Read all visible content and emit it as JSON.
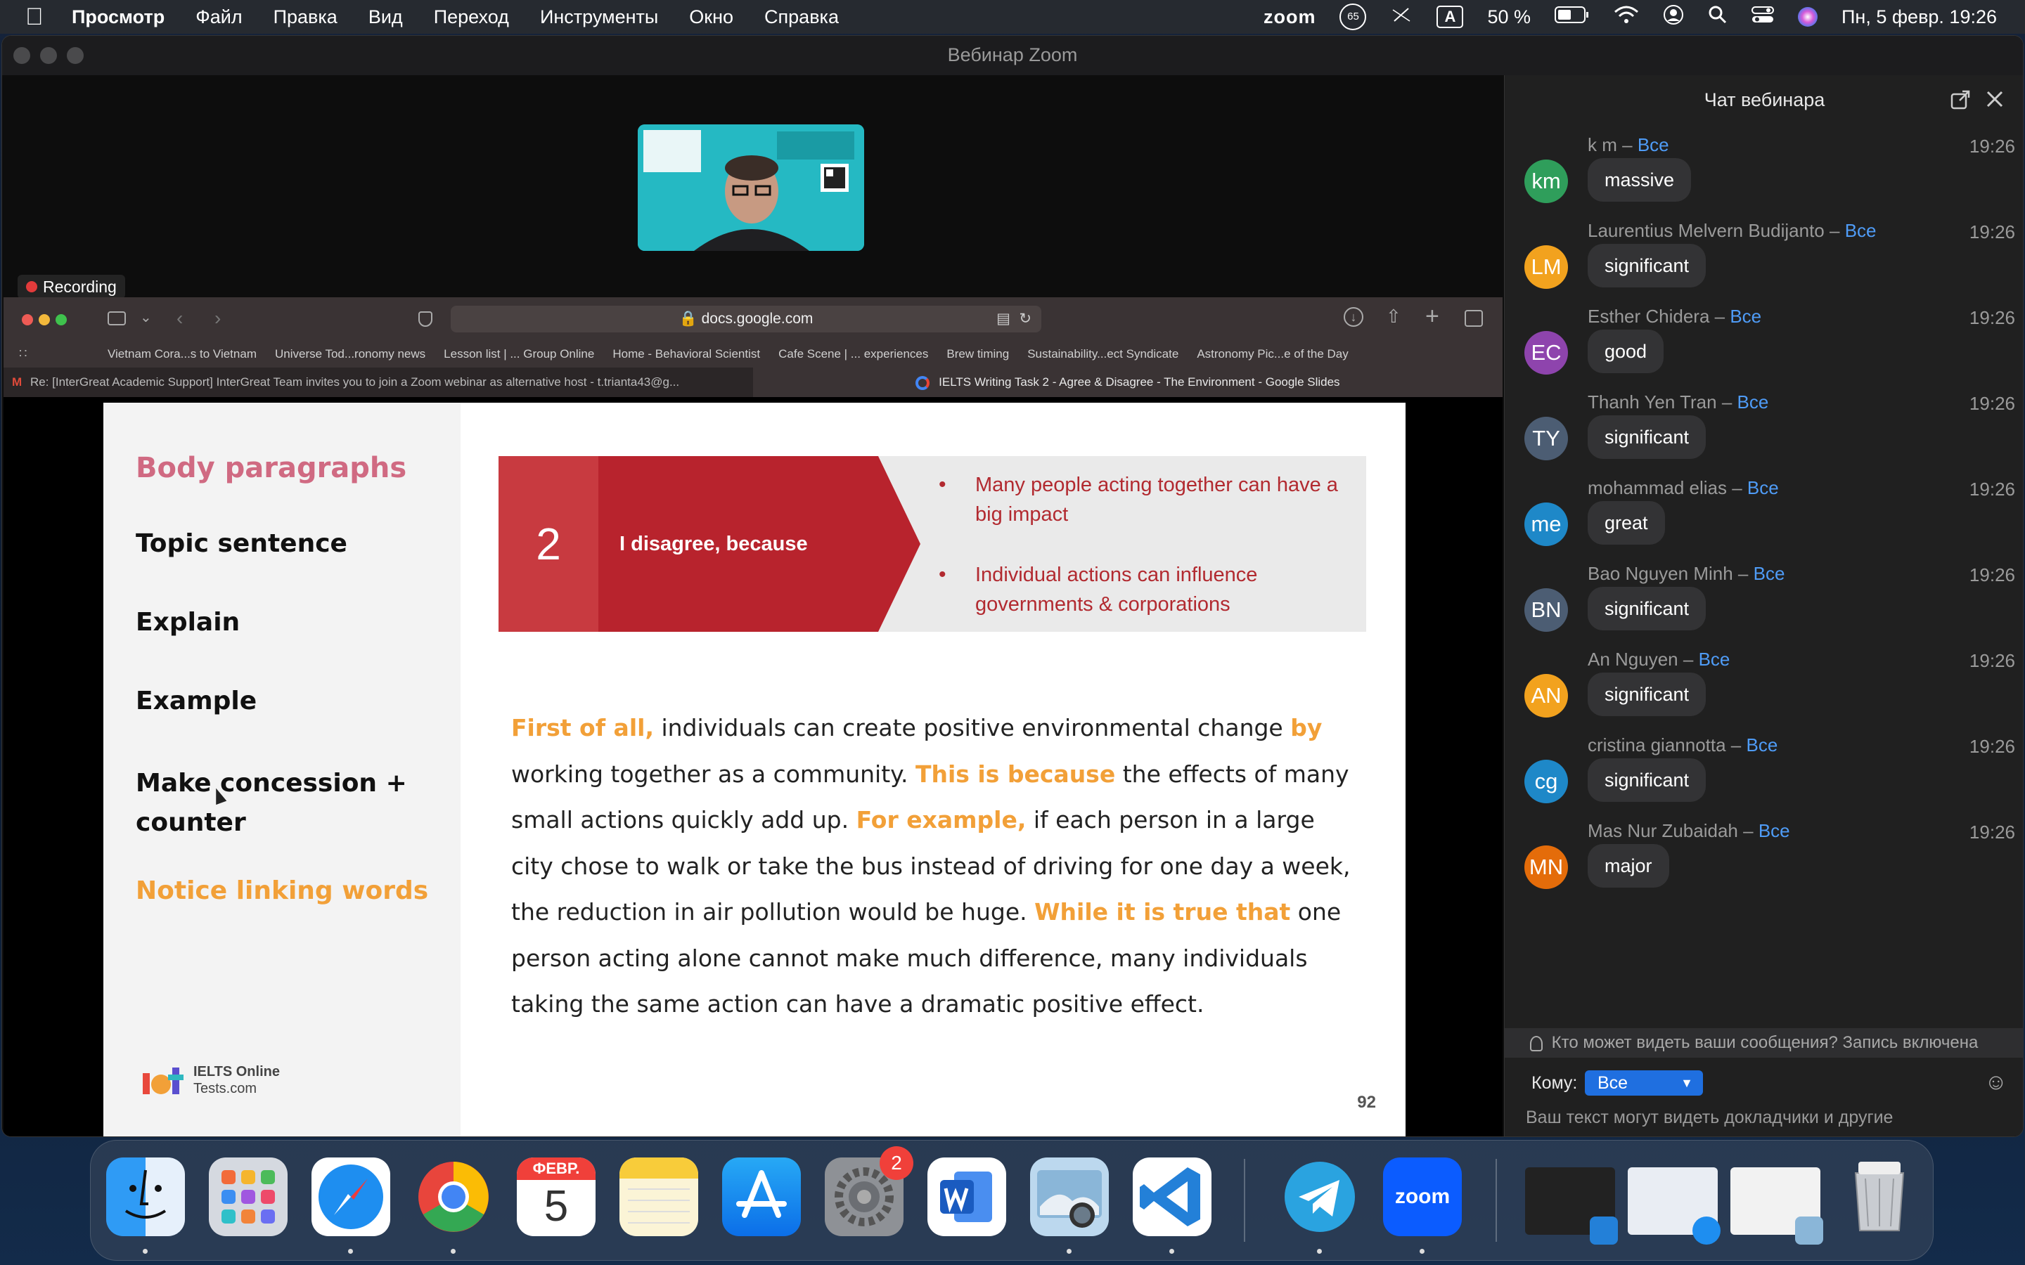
{
  "menubar": {
    "app_name": "Просмотр",
    "items": [
      "Файл",
      "Правка",
      "Вид",
      "Переход",
      "Инструменты",
      "Окно",
      "Справка"
    ],
    "zoom_label": "zoom",
    "notif_count": "65",
    "input_source": "A",
    "battery": "50 %",
    "datetime": "Пн, 5 февр.  19:26"
  },
  "window": {
    "title": "Вебинар Zoom"
  },
  "video": {
    "recording_label": "Recording"
  },
  "browser": {
    "url": "docs.google.com",
    "bookmarks": [
      "Vietnam Cora...s to Vietnam",
      "Universe Tod...ronomy news",
      "Lesson list | ... Group Online",
      "Home - Behavioral Scientist",
      "Cafe Scene | ... experiences",
      "Brew timing",
      "Sustainability...ect Syndicate",
      "Astronomy Pic...e of the Day"
    ],
    "tab1": "Re: [InterGreat Academic Support] InterGreat Team invites you to join a Zoom webinar as alternative host - t.trianta43@g...",
    "tab2": "IELTS Writing Task 2 - Agree & Disagree - The Environment - Google Slides"
  },
  "slide": {
    "left_items": [
      "Body paragraphs",
      "Topic sentence",
      "Explain",
      "Example",
      "Make concession + counter",
      "Notice linking words"
    ],
    "banner_number": "2",
    "banner_label": "I disagree, because",
    "bullets": [
      "Many people acting together can have a big impact",
      "Individual actions can influence governments & corporations"
    ],
    "paragraph": [
      {
        "t": "First of all,",
        "hl": true
      },
      {
        "t": " individuals can create positive environmental change ",
        "hl": false
      },
      {
        "t": "by",
        "hl": true
      },
      {
        "t": " working together as a community. ",
        "hl": false
      },
      {
        "t": "This is because",
        "hl": true
      },
      {
        "t": " the effects of many small actions quickly add up. ",
        "hl": false
      },
      {
        "t": "For example,",
        "hl": true
      },
      {
        "t": " if each person in a large city chose to walk or take the bus instead of driving for one day a week, the reduction in air pollution would be huge. ",
        "hl": false
      },
      {
        "t": "While it is true that",
        "hl": true
      },
      {
        "t": " one person acting alone cannot make much difference, many individuals taking the same action can have a dramatic positive effect.",
        "hl": false
      }
    ],
    "logo_line1": "IELTS Online",
    "logo_line2": "Tests.com",
    "page_number": "92"
  },
  "chat": {
    "title": "Чат вебинара",
    "partial_message": "massive",
    "messages": [
      {
        "initials": "km",
        "color": "#2f9e5b",
        "name": "k m",
        "to": "Все",
        "time": "19:26",
        "text": "massive"
      },
      {
        "initials": "LM",
        "color": "#f2a21e",
        "name": "Laurentius Melvern Budijanto",
        "to": "Все",
        "time": "19:26",
        "text": "significant"
      },
      {
        "initials": "EC",
        "color": "#8e44ad",
        "name": "Esther Chidera",
        "to": "Все",
        "time": "19:26",
        "text": "good"
      },
      {
        "initials": "TY",
        "color": "#4c5d73",
        "name": "Thanh Yen Tran",
        "to": "Все",
        "time": "19:26",
        "text": "significant"
      },
      {
        "initials": "me",
        "color": "#1e88c8",
        "name": "mohammad elias",
        "to": "Все",
        "time": "19:26",
        "text": "great"
      },
      {
        "initials": "BN",
        "color": "#4c5d73",
        "name": "Bao Nguyen Minh",
        "to": "Все",
        "time": "19:26",
        "text": "significant"
      },
      {
        "initials": "AN",
        "color": "#f2a21e",
        "name": "An Nguyen",
        "to": "Все",
        "time": "19:26",
        "text": "significant"
      },
      {
        "initials": "cg",
        "color": "#1e88c8",
        "name": "cristina giannotta",
        "to": "Все",
        "time": "19:26",
        "text": "significant"
      },
      {
        "initials": "MN",
        "color": "#e46c0a",
        "name": "Mas Nur Zubaidah",
        "to": "Все",
        "time": "19:26",
        "text": "major"
      }
    ],
    "notice": "Кто может видеть ваши сообщения? Запись включена",
    "to_label": "Кому:",
    "to_value": "Все",
    "placeholder": "Ваш текст могут видеть докладчики и другие участники"
  },
  "dock": {
    "calendar_month": "ФЕВР.",
    "calendar_day": "5",
    "settings_badge": "2",
    "zoom_label": "zoom",
    "apps": [
      "finder-icon",
      "launchpad-icon",
      "safari-icon",
      "chrome-icon",
      "calendar-icon",
      "notes-icon",
      "app-store-icon",
      "system-settings-icon",
      "word-icon",
      "preview-icon",
      "vscode-icon",
      "telegram-icon",
      "zoom-icon",
      "trash-icon"
    ]
  }
}
